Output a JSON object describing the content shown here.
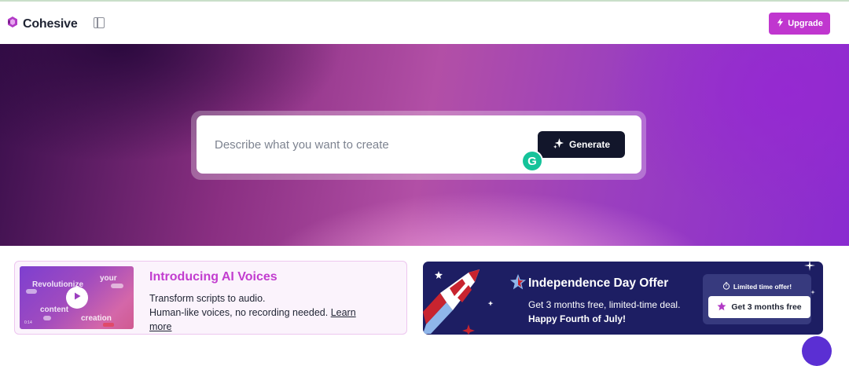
{
  "header": {
    "logo_text": "Cohesive",
    "upgrade_label": "Upgrade"
  },
  "hero": {
    "prompt_placeholder": "Describe what you want to create",
    "generate_label": "Generate",
    "grammarly_glyph": "G"
  },
  "voices_card": {
    "thumbnail_words": [
      "Revolutionize",
      "your",
      "content",
      "creation"
    ],
    "thumbnail_time": "0:14",
    "title": "Introducing AI Voices",
    "line1": "Transform scripts to audio.",
    "line2": "Human-like voices, no recording needed.",
    "learn_more": "Learn more"
  },
  "promo_card": {
    "title": "Independence Day Offer",
    "desc_plain": "Get 3 months free, limited-time deal.",
    "desc_bold": "Happy Fourth of July!",
    "offer_label": "Limited time offer!",
    "offer_button": "Get 3 months free"
  },
  "colors": {
    "brand": "#c036cf",
    "dark_button": "#12162b",
    "promo_bg": "#1d1e63",
    "voices_title": "#c23dcf"
  },
  "icons": [
    "cohesive-logo-icon",
    "sidebar-toggle-icon",
    "lightning-icon",
    "sparkle-icon",
    "grammarly-icon",
    "play-icon",
    "rocket-icon",
    "star-icon",
    "timer-icon",
    "chat-bubble-icon"
  ]
}
